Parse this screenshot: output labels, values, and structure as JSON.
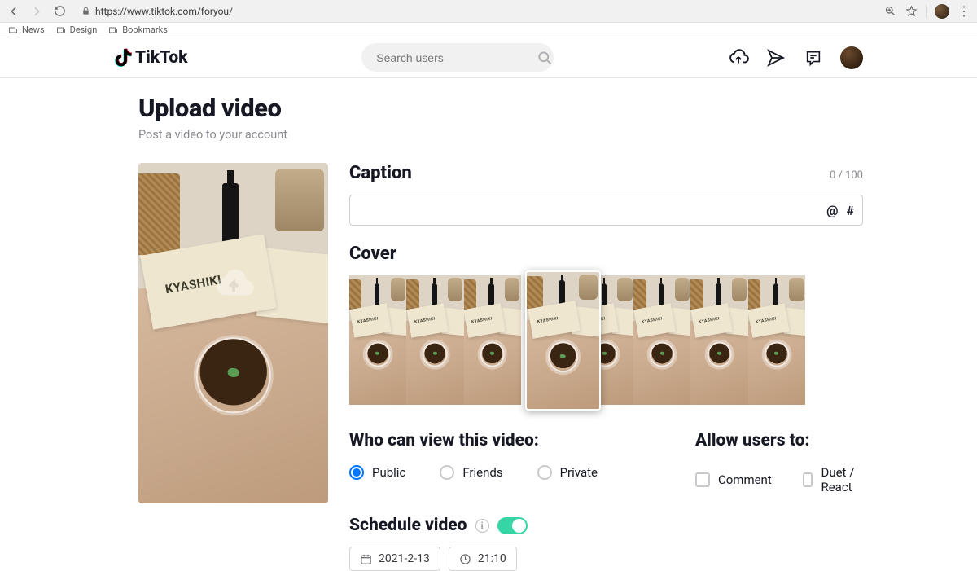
{
  "browser": {
    "url": "https://www.tiktok.com/foryou/",
    "bookmarks": [
      "News",
      "Design",
      "Bookmarks"
    ]
  },
  "header": {
    "brand": "TikTok",
    "search_placeholder": "Search users"
  },
  "page": {
    "title": "Upload video",
    "subtitle": "Post a video to your account"
  },
  "preview": {
    "card_text": "KYASHIKI"
  },
  "caption": {
    "section": "Caption",
    "counter": "0 / 100",
    "value": "",
    "mention": "@",
    "hashtag": "#"
  },
  "cover": {
    "section": "Cover",
    "thumb_text": "KYASHIKI"
  },
  "visibility": {
    "section": "Who can view this video:",
    "options": {
      "public": "Public",
      "friends": "Friends",
      "private": "Private"
    }
  },
  "allow": {
    "section": "Allow users to:",
    "options": {
      "comment": "Comment",
      "duet": "Duet / React"
    }
  },
  "schedule": {
    "section": "Schedule video",
    "date": "2021-2-13",
    "time": "21:10"
  }
}
